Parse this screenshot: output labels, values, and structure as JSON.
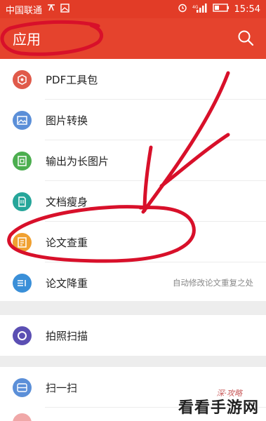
{
  "statusbar": {
    "carrier": "中国联通",
    "time": "15:54"
  },
  "appbar": {
    "title": "应用"
  },
  "items": [
    {
      "label": "PDF工具包",
      "icon": "pdf-toolkit-icon",
      "color": "#e05a4a"
    },
    {
      "label": "图片转换",
      "icon": "image-convert-icon",
      "color": "#5b8fd8"
    },
    {
      "label": "输出为长图片",
      "icon": "long-image-icon",
      "color": "#4cae4f"
    },
    {
      "label": "文档瘦身",
      "icon": "doc-slim-icon",
      "color": "#26a69a"
    },
    {
      "label": "论文查重",
      "icon": "paper-check-icon",
      "color": "#f0a030"
    },
    {
      "label": "论文降重",
      "icon": "paper-reduce-icon",
      "color": "#3a8fd8",
      "hint": "自动修改论文重复之处"
    }
  ],
  "scan": {
    "label": "拍照扫描",
    "icon": "camera-scan-icon",
    "color": "#5b4fb3"
  },
  "qr": {
    "label": "扫一扫",
    "icon": "scan-qr-icon",
    "color": "#5b8fd8"
  },
  "watermark": {
    "text": "看看手游网",
    "sub": "深·攻略"
  }
}
